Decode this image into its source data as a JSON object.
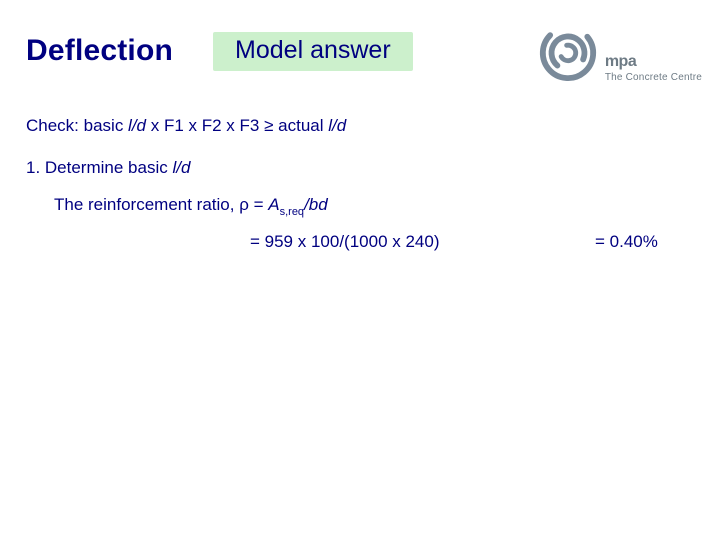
{
  "header": {
    "title": "Deflection",
    "badge": "Model answer",
    "logo": {
      "brand": "mpa",
      "sub1": "The Concrete Centre"
    }
  },
  "content": {
    "check_prefix": "Check: basic ",
    "lod1": "l/d",
    "check_mid": " x F1 x F2 x F3 ≥ actual ",
    "lod2": "l/d",
    "step1_prefix": "1. Determine basic ",
    "step1_lod": "l/d",
    "ratio_prefix": "The reinforcement ratio, ρ = ",
    "ratio_A": "A",
    "ratio_sub": "s,req",
    "ratio_over": "/bd",
    "calc": "= 959 x 100/(1000 x 240)",
    "result": "= 0.40%"
  }
}
